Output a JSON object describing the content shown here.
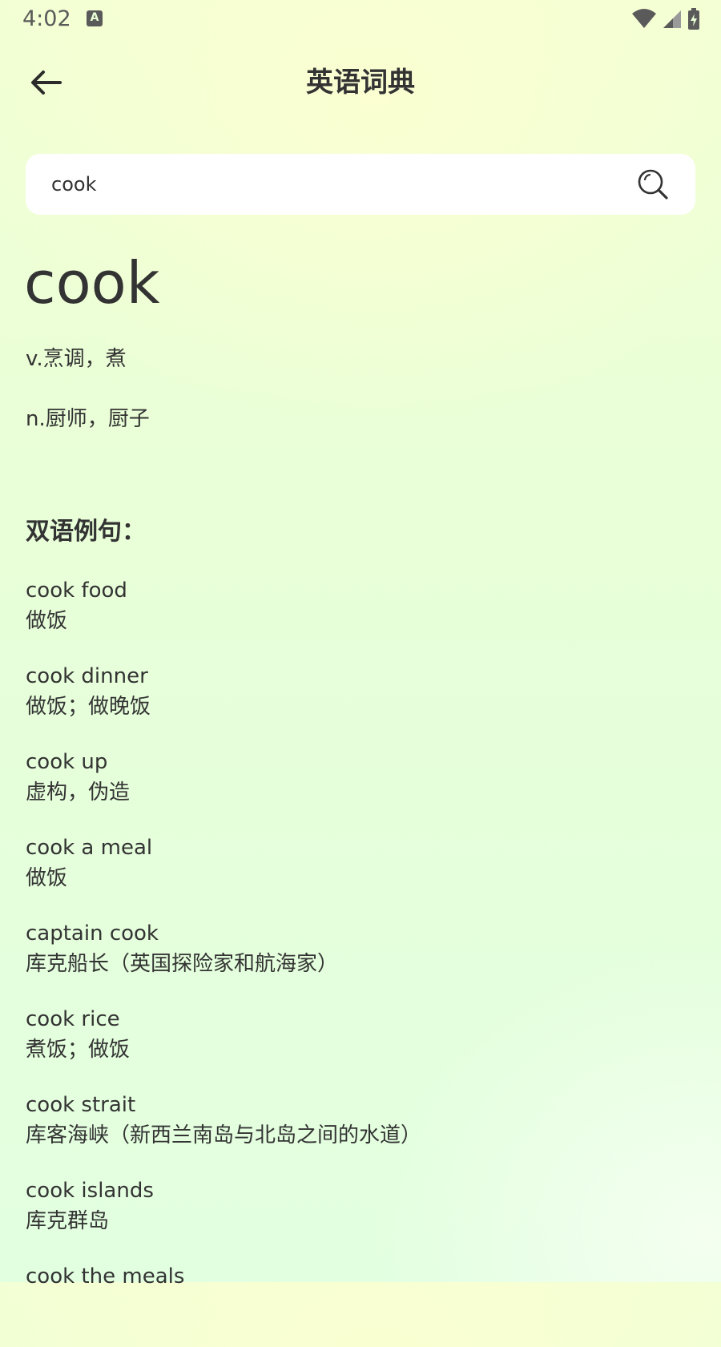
{
  "status_bar": {
    "time": "4:02",
    "keyboard_icon_letter": "A",
    "icons": [
      "keyboard-indicator-icon",
      "wifi-icon",
      "cell-signal-icon",
      "battery-charging-icon"
    ]
  },
  "header": {
    "back_icon": "arrow-left-icon",
    "title": "英语词典"
  },
  "search": {
    "value": "cook",
    "icon": "search-icon"
  },
  "entry": {
    "word": "cook",
    "definitions": [
      "v.烹调，煮",
      "n.厨师，厨子"
    ]
  },
  "examples": {
    "heading": "双语例句：",
    "items": [
      {
        "en": "cook food",
        "zh": "做饭"
      },
      {
        "en": "cook dinner",
        "zh": "做饭；做晚饭"
      },
      {
        "en": "cook up",
        "zh": "虚构，伪造"
      },
      {
        "en": "cook a meal",
        "zh": "做饭"
      },
      {
        "en": "captain cook",
        "zh": "库克船长（英国探险家和航海家）"
      },
      {
        "en": "cook rice",
        "zh": "煮饭；做饭"
      },
      {
        "en": "cook strait",
        "zh": "库客海峡（新西兰南岛与北岛之间的水道）"
      },
      {
        "en": "cook islands",
        "zh": "库克群岛"
      },
      {
        "en": "cook the meals",
        "zh": ""
      }
    ]
  },
  "colors": {
    "text": "#333333",
    "search_background": "#ffffff",
    "background_top": "#f2ffd4",
    "background_bottom": "#e2ffe0"
  }
}
